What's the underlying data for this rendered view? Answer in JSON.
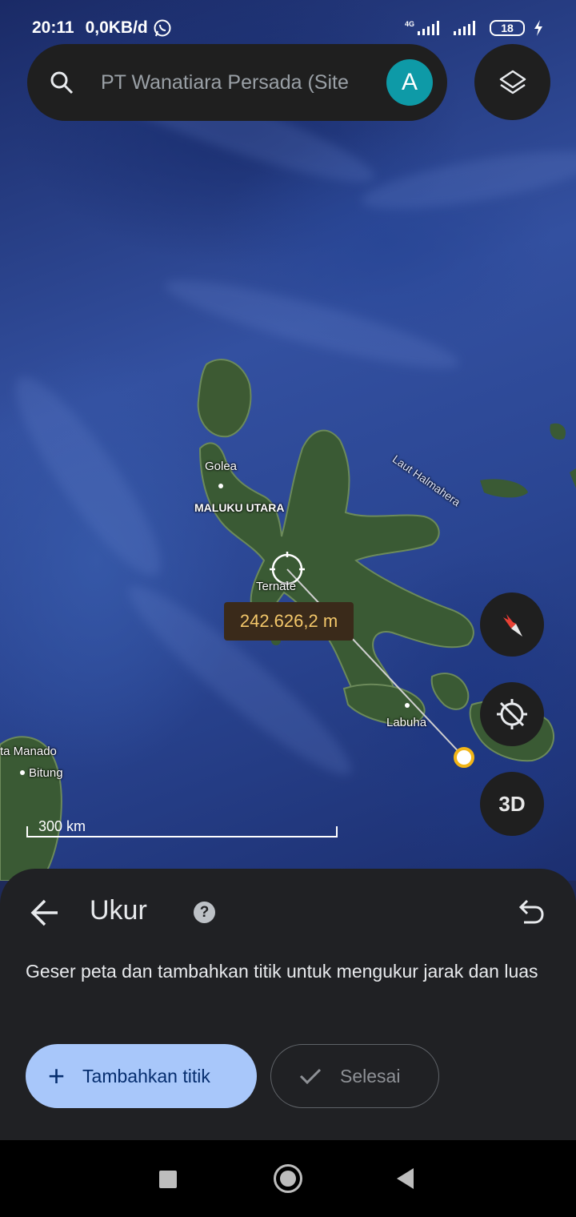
{
  "status_bar": {
    "time": "20:11",
    "data_rate": "0,0KB/d",
    "network_type": "4G",
    "battery_level": "18"
  },
  "search": {
    "placeholder": "PT Wanatiara Persada (Site",
    "avatar_initial": "A"
  },
  "map": {
    "labels": {
      "golea": "Golea",
      "maluku_utara": "MALUKU UTARA",
      "ternate": "Ternate",
      "labuha": "Labuha",
      "laut_halmahera": "Laut Halmahera",
      "manado": "ta Manado",
      "bitung": "Bitung"
    },
    "measurement": "242.626,2 m",
    "scale_label": "300 km",
    "three_d_label": "3D"
  },
  "sheet": {
    "title": "Ukur",
    "description": "Geser peta dan tambahkan titik untuk mengukur jarak dan luas",
    "add_point_label": "Tambahkan titik",
    "done_label": "Selesai"
  },
  "icons": {
    "search": "search-icon",
    "layers": "layers-icon",
    "compass": "compass-icon",
    "location": "location-off-icon",
    "back": "arrow-back-icon",
    "help": "help-icon",
    "undo": "undo-icon",
    "plus": "plus-icon",
    "check": "check-icon",
    "whatsapp": "whatsapp-icon",
    "charging": "charging-icon"
  },
  "colors": {
    "accent_button": "#a8c7fa",
    "avatar_bg": "#0e9aa7",
    "measure_text": "#f3c76a",
    "sheet_bg": "#202124"
  }
}
